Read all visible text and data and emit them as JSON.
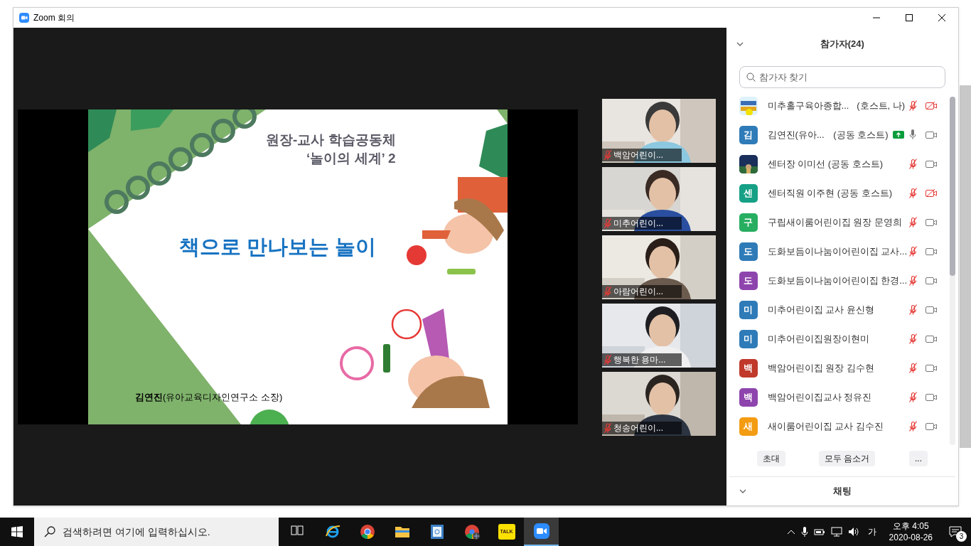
{
  "window": {
    "title": "Zoom 회의"
  },
  "slide": {
    "title_lines": [
      "원장-교사 학습공동체",
      "‘놀이의 세계’ 2"
    ],
    "heading": "책으로 만나보는 놀이",
    "author": "**김연진**(유아교육디자인연구소 소장)"
  },
  "video_tiles": [
    {
      "name": "백암어린이...",
      "muted": true
    },
    {
      "name": "미추어린이...",
      "muted": true
    },
    {
      "name": "아람어린이...",
      "muted": true
    },
    {
      "name": "행복한 용마...",
      "muted": true
    },
    {
      "name": "청송어린이...",
      "muted": true
    }
  ],
  "participants_panel": {
    "title": "참가자(24)",
    "search": {
      "placeholder": "참가자 찾기"
    },
    "participants": [
      {
        "name": "미추홀구육아종합...",
        "role": "(호스트, 나)",
        "muted": true,
        "video_off": true,
        "sharing": false
      },
      {
        "name": "김연진(유아...",
        "role": "(공동 호스트)",
        "avatar": {
          "kind": "initial",
          "letter": "김",
          "color": "#2e7bb8"
        },
        "muted": false,
        "video_off": false,
        "sharing": true
      },
      {
        "name": "센터장 이미선 (공동 호스트)",
        "muted": true,
        "video_off": false,
        "sharing": false
      },
      {
        "name": "센터직원 이주현 (공동 호스트)",
        "avatar": {
          "kind": "initial",
          "letter": "센",
          "color": "#16a085"
        },
        "muted": true,
        "video_off": true,
        "sharing": false
      },
      {
        "name": "구립새이룸어린이집 원장 문영희",
        "avatar": {
          "kind": "initial",
          "letter": "구",
          "color": "#27ae60"
        },
        "muted": true,
        "video_off": false,
        "sharing": false
      },
      {
        "name": "도화보듬이나눔이어린이집 교사...",
        "avatar": {
          "kind": "initial",
          "letter": "도",
          "color": "#2e7bb8"
        },
        "muted": true,
        "video_off": false,
        "sharing": false
      },
      {
        "name": "도화보듬이나눔이어린이집 한경...",
        "avatar": {
          "kind": "initial",
          "letter": "도",
          "color": "#8e44ad"
        },
        "muted": true,
        "video_off": false,
        "sharing": false
      },
      {
        "name": "미추어린이집 교사 윤신형",
        "avatar": {
          "kind": "initial",
          "letter": "미",
          "color": "#2e7bb8"
        },
        "muted": true,
        "video_off": false,
        "sharing": false
      },
      {
        "name": "미추어린이집원장이현미",
        "avatar": {
          "kind": "initial",
          "letter": "미",
          "color": "#2e7bb8"
        },
        "muted": true,
        "video_off": false,
        "sharing": false
      },
      {
        "name": "백암어린이집 원장 김수현",
        "avatar": {
          "kind": "initial",
          "letter": "백",
          "color": "#c0392b"
        },
        "muted": true,
        "video_off": false,
        "sharing": false
      },
      {
        "name": "백암어린이집교사 정유진",
        "avatar": {
          "kind": "initial",
          "letter": "백",
          "color": "#8e44ad"
        },
        "muted": true,
        "video_off": false,
        "sharing": false
      },
      {
        "name": "새이룸어린이집 교사 김수진",
        "avatar": {
          "kind": "initial",
          "letter": "새",
          "color": "#f39c12"
        },
        "muted": true,
        "video_off": false,
        "sharing": false
      }
    ],
    "buttons": [
      "초대",
      "모두 음소거",
      "..."
    ]
  },
  "chat_panel": {
    "title": "채팅"
  },
  "taskbar": {
    "search": {
      "placeholder": "검색하려면 여기에 입력하십시오."
    },
    "apps": [
      {
        "kind": "taskview",
        "selected": false
      },
      {
        "kind": "ie",
        "selected": false
      },
      {
        "kind": "chrome",
        "selected": false
      },
      {
        "kind": "explorer",
        "selected": false
      },
      {
        "kind": "hangul",
        "selected": false
      },
      {
        "kind": "chrome2",
        "selected": false
      },
      {
        "kind": "kakao",
        "label": "TALK",
        "selected": false
      },
      {
        "kind": "zoom",
        "selected": true
      }
    ],
    "ime": "가",
    "time": "오후 4:05",
    "date": "2020-08-26",
    "notifications": "3"
  }
}
